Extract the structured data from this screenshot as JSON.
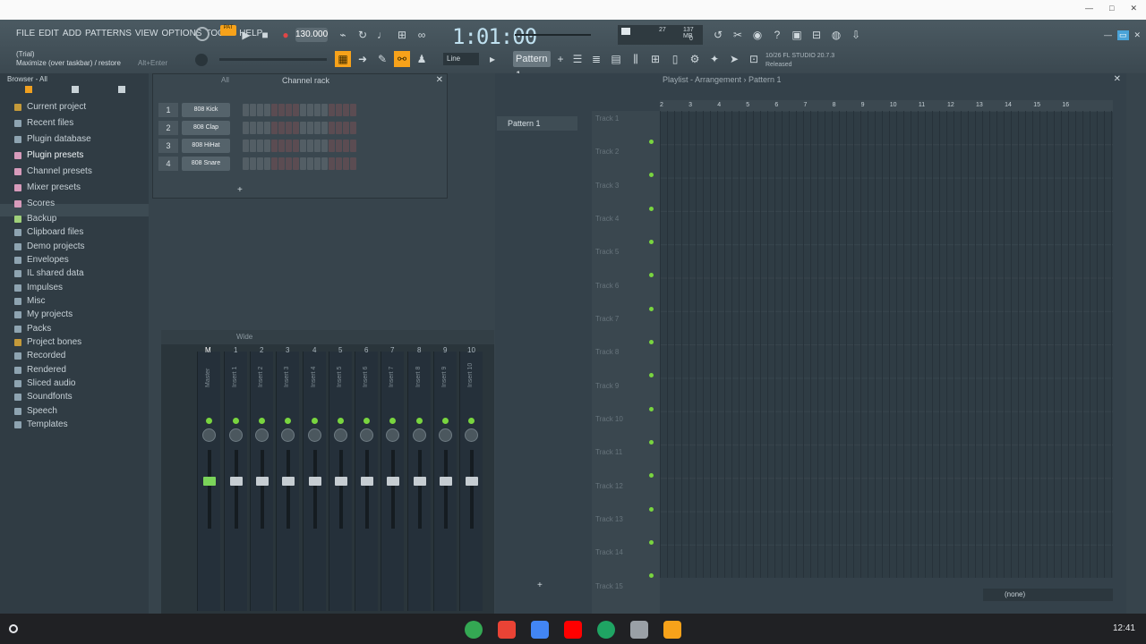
{
  "menu": {
    "items": [
      "FILE",
      "EDIT",
      "ADD",
      "PATTERNS",
      "VIEW",
      "OPTIONS",
      "TOOLS",
      "HELP"
    ]
  },
  "hint": {
    "line1": "(Trial)",
    "line2": "Maximize (over taskbar) / restore",
    "shortcut": "Alt+Enter"
  },
  "transport": {
    "tempo": "130.000",
    "time": "1:01:00",
    "pattern": "Pattern 1",
    "snap": "Line"
  },
  "stats": {
    "mem": "137 MB",
    "voices": "27",
    "cpu": "0"
  },
  "news": {
    "line1": "10/26  FL STUDIO 20.7.3",
    "line2": "Released"
  },
  "browser": {
    "title": "Browser - All",
    "items": [
      "Current project",
      "Recent files",
      "Plugin database",
      "Plugin presets",
      "Channel presets",
      "Mixer presets",
      "Scores",
      "Backup",
      "Clipboard files",
      "Demo projects",
      "Envelopes",
      "IL shared data",
      "Impulses",
      "Misc",
      "My projects",
      "Packs",
      "Project bones",
      "Recorded",
      "Rendered",
      "Sliced audio",
      "Soundfonts",
      "Speech",
      "Templates"
    ]
  },
  "channel_rack": {
    "title": "Channel rack",
    "filter": "All",
    "channels": [
      {
        "num": "1",
        "name": "808 Kick"
      },
      {
        "num": "2",
        "name": "808 Clap"
      },
      {
        "num": "3",
        "name": "808 HiHat"
      },
      {
        "num": "4",
        "name": "808 Snare"
      }
    ]
  },
  "mixer": {
    "view": "Wide",
    "strips": [
      "Master",
      "Insert 1",
      "Insert 2",
      "Insert 3",
      "Insert 4",
      "Insert 5",
      "Insert 6",
      "Insert 7",
      "Insert 8",
      "Insert 9",
      "Insert 10"
    ],
    "nums": [
      "M",
      "1",
      "2",
      "3",
      "4",
      "5",
      "6",
      "7",
      "8",
      "9",
      "10"
    ]
  },
  "playlist": {
    "title": "Playlist - Arrangement › Pattern 1",
    "pattern": "Pattern 1",
    "tracks": [
      "Track 1",
      "Track 2",
      "Track 3",
      "Track 4",
      "Track 5",
      "Track 6",
      "Track 7",
      "Track 8",
      "Track 9",
      "Track 10",
      "Track 11",
      "Track 12",
      "Track 13",
      "Track 14",
      "Track 15"
    ],
    "bars": [
      "2",
      "3",
      "4",
      "5",
      "6",
      "7",
      "8",
      "9",
      "10",
      "11",
      "12",
      "13",
      "14",
      "15",
      "16"
    ],
    "none_label": "(none)"
  },
  "taskbar": {
    "clock": "12:41"
  }
}
